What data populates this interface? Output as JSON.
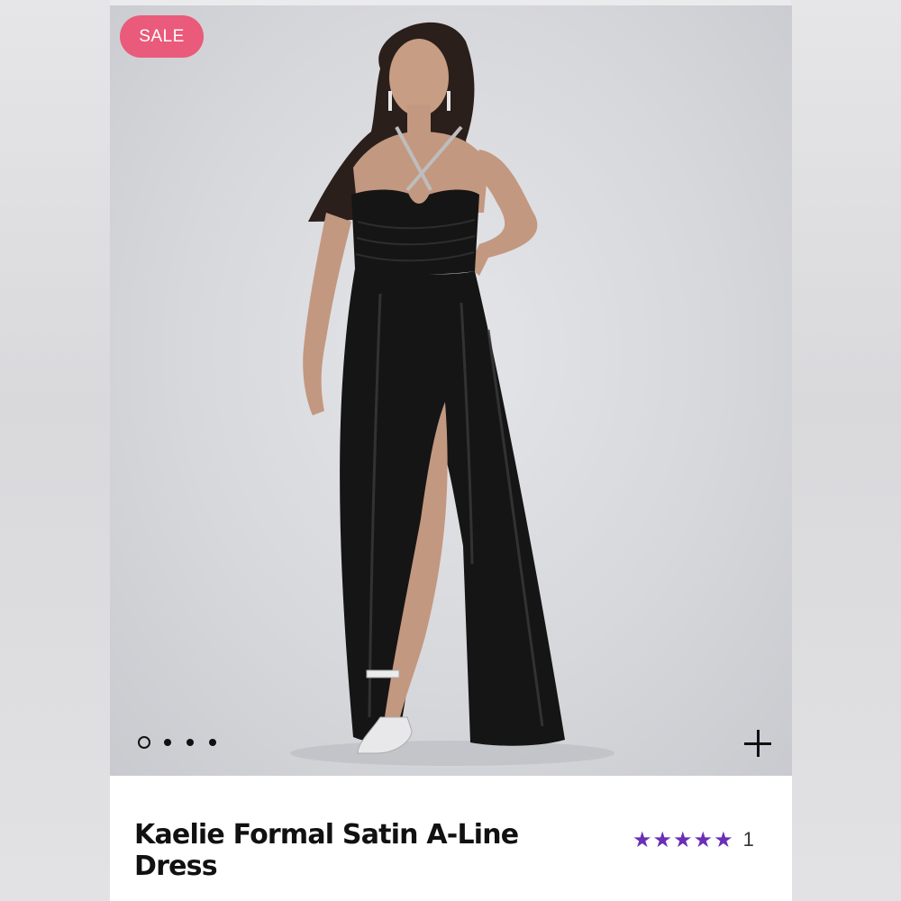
{
  "badge": {
    "label": "SALE"
  },
  "product": {
    "title": "Kaelie Formal Satin A-Line Dress",
    "rating_stars": "★★★★★",
    "rating_value": 5,
    "review_count": "1"
  },
  "gallery": {
    "total_images": 4,
    "active_index": 0
  },
  "colors": {
    "sale_badge": "#ea5a7a",
    "stars": "#6a2eb8",
    "dress": "#151515"
  },
  "icons": {
    "zoom": "plus-icon"
  }
}
